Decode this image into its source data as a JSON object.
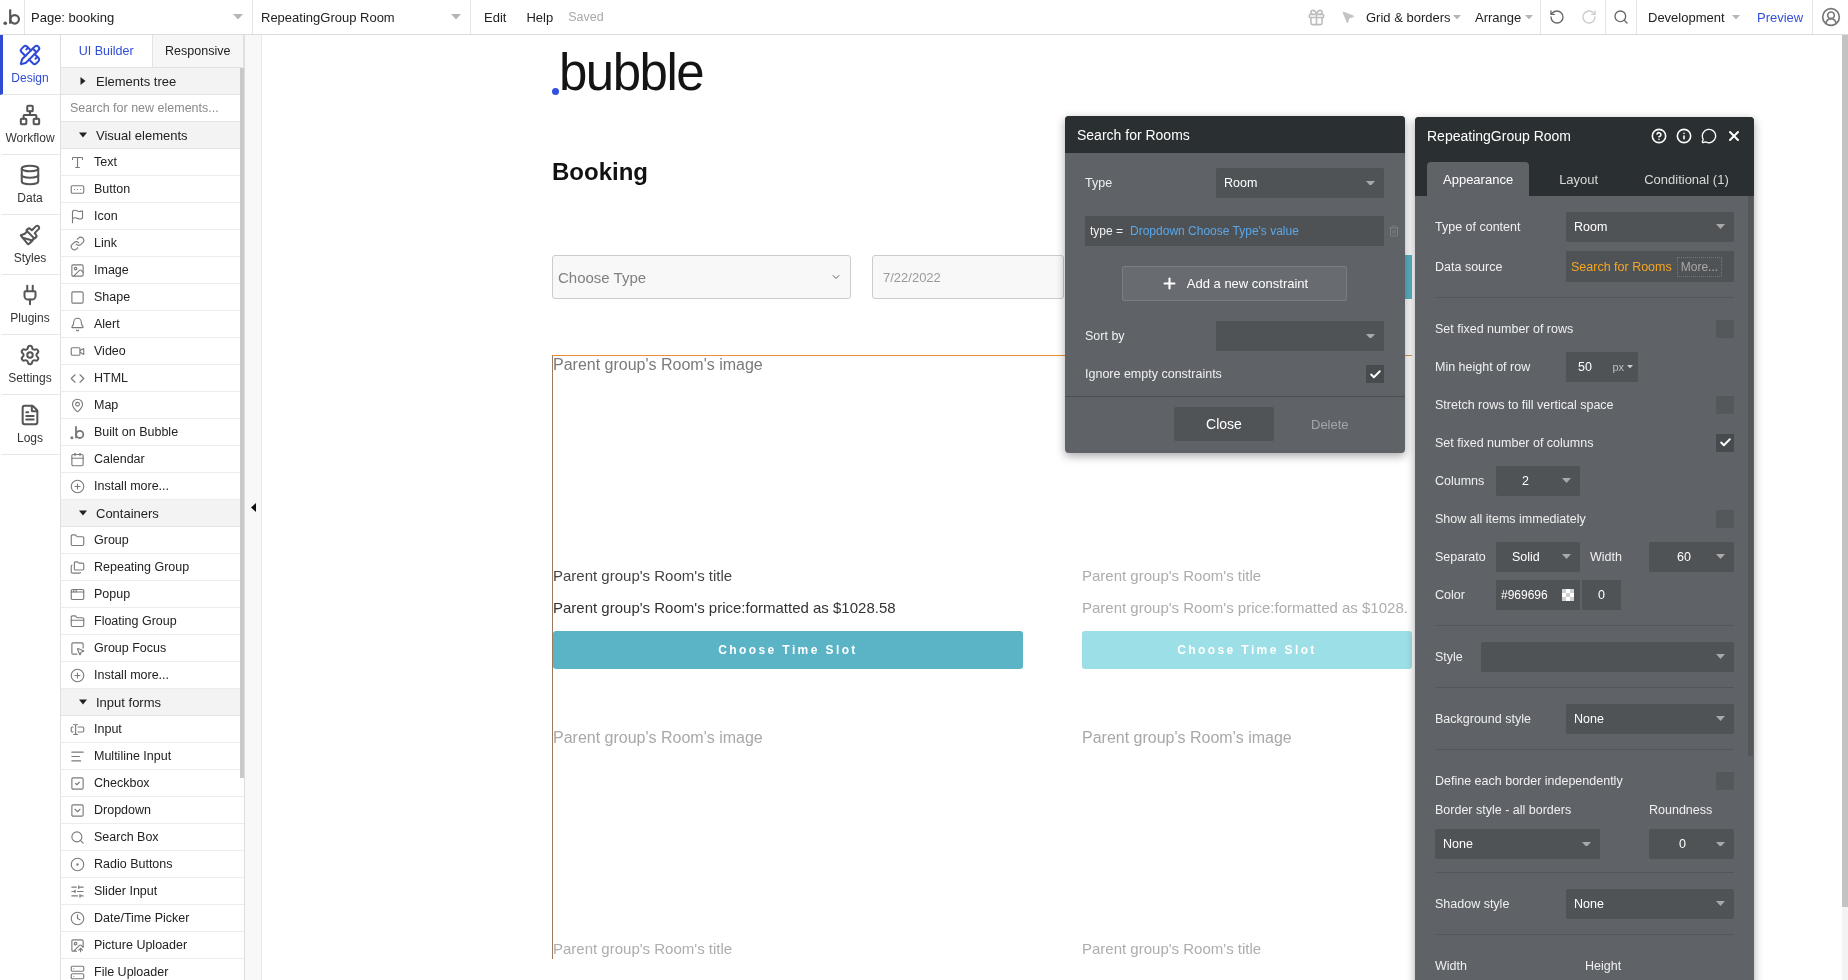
{
  "top_bar": {
    "page_selector": "Page: booking",
    "element_selector": "RepeatingGroup Room",
    "menu": [
      "Edit",
      "Help"
    ],
    "save_status": "Saved",
    "view_menus": [
      "Grid & borders",
      "Arrange"
    ],
    "undo": {
      "disabled": false
    },
    "redo": {
      "disabled": true
    },
    "version": "Development",
    "preview": "Preview"
  },
  "nav": [
    {
      "kind": "design",
      "label": "Design",
      "selected": true
    },
    {
      "kind": "workflow",
      "label": "Workflow",
      "selected": false
    },
    {
      "kind": "data",
      "label": "Data",
      "selected": false
    },
    {
      "kind": "styles",
      "label": "Styles",
      "selected": false
    },
    {
      "kind": "plugins",
      "label": "Plugins",
      "selected": false
    },
    {
      "kind": "settings",
      "label": "Settings",
      "selected": false
    },
    {
      "kind": "logs",
      "label": "Logs",
      "selected": false
    }
  ],
  "elements_panel": {
    "tabs": [
      {
        "label": "UI Builder",
        "selected": true
      },
      {
        "label": "Responsive",
        "selected": false
      }
    ],
    "tree": {
      "label": "Elements tree",
      "expanded": false
    },
    "search": {
      "placeholder": "Search for new elements..."
    },
    "groups": [
      {
        "label": "Visual elements",
        "expanded": true,
        "items": [
          {
            "kind": "text",
            "label": "Text"
          },
          {
            "kind": "button",
            "label": "Button"
          },
          {
            "kind": "icon",
            "label": "Icon"
          },
          {
            "kind": "link",
            "label": "Link"
          },
          {
            "kind": "image",
            "label": "Image"
          },
          {
            "kind": "shape",
            "label": "Shape"
          },
          {
            "kind": "alert",
            "label": "Alert"
          },
          {
            "kind": "video",
            "label": "Video"
          },
          {
            "kind": "html",
            "label": "HTML"
          },
          {
            "kind": "map",
            "label": "Map"
          },
          {
            "kind": "logo",
            "label": "Built on Bubble"
          },
          {
            "kind": "calendar",
            "label": "Calendar"
          },
          {
            "kind": "install",
            "label": "Install more..."
          }
        ]
      },
      {
        "label": "Containers",
        "expanded": true,
        "items": [
          {
            "kind": "group",
            "label": "Group"
          },
          {
            "kind": "repeating",
            "label": "Repeating Group"
          },
          {
            "kind": "popup",
            "label": "Popup"
          },
          {
            "kind": "floating",
            "label": "Floating Group"
          },
          {
            "kind": "focus",
            "label": "Group Focus"
          },
          {
            "kind": "install",
            "label": "Install more..."
          }
        ]
      },
      {
        "label": "Input forms",
        "expanded": true,
        "items": [
          {
            "kind": "input",
            "label": "Input"
          },
          {
            "kind": "multiline",
            "label": "Multiline Input"
          },
          {
            "kind": "checkbox",
            "label": "Checkbox"
          },
          {
            "kind": "dropdown",
            "label": "Dropdown"
          },
          {
            "kind": "search",
            "label": "Search Box"
          },
          {
            "kind": "radio",
            "label": "Radio Buttons"
          },
          {
            "kind": "slider",
            "label": "Slider Input"
          },
          {
            "kind": "datetime",
            "label": "Date/Time Picker"
          },
          {
            "kind": "picture",
            "label": "Picture Uploader"
          },
          {
            "kind": "file",
            "label": "File Uploader"
          }
        ]
      }
    ]
  },
  "canvas": {
    "logo": "bubble",
    "heading": "Booking",
    "type_dropdown": {
      "placeholder": "Choose Type"
    },
    "date_input": {
      "placeholder": "7/22/2022"
    },
    "repeating_group": {
      "rows": [
        {
          "cells": [
            {
              "image": "Parent group's Room's image",
              "title": "Parent group's Room's title",
              "price": "Parent group's Room's price:formatted as $1028.58",
              "button": "Choose Time Slot",
              "dimmed": false
            },
            {
              "title": "Parent group's Room's title",
              "price": "Parent group's Room's price:formatted as $1028.",
              "button": "Choose Time Slot",
              "dimmed": true
            }
          ]
        },
        {
          "cells": [
            {
              "image": "Parent group's Room's image",
              "title": "Parent group's Room's title",
              "dimmed": true
            },
            {
              "image": "Parent group's Room's image",
              "title": "Parent group's Room's title",
              "dimmed": true
            }
          ]
        }
      ]
    }
  },
  "search_panel": {
    "title": "Search for Rooms",
    "type": {
      "label": "Type",
      "value": "Room"
    },
    "constraints": [
      {
        "field": "type =",
        "value": "Dropdown Choose Type's value"
      }
    ],
    "add_button": "Add a new constraint",
    "sort": {
      "label": "Sort by"
    },
    "ignore_empty": {
      "label": "Ignore empty constraints",
      "checked": true
    },
    "close_button": "Close",
    "delete_button": {
      "label": "Delete",
      "disabled": true
    }
  },
  "property_panel": {
    "title": "RepeatingGroup Room",
    "tabs": [
      {
        "label": "Appearance",
        "selected": true
      },
      {
        "label": "Layout",
        "selected": false
      },
      {
        "label": "Conditional (1)",
        "selected": false
      }
    ],
    "sections": [
      {
        "rows": [
          {
            "kind": "select",
            "label": "Type of content",
            "value": "Room"
          },
          {
            "kind": "source",
            "label": "Data source",
            "value": "Search for Rooms",
            "more": "More..."
          }
        ]
      },
      {
        "rows": [
          {
            "kind": "toggle",
            "label": "Set fixed number of rows",
            "checked": false
          },
          {
            "kind": "number",
            "label": "Min height of row",
            "value": "50",
            "unit": "px"
          },
          {
            "kind": "toggle",
            "label": "Stretch rows to fill vertical space",
            "checked": false
          },
          {
            "kind": "toggle",
            "label": "Set fixed number of columns",
            "checked": true
          },
          {
            "kind": "small-select",
            "label": "Columns",
            "value": "2"
          },
          {
            "kind": "toggle",
            "label": "Show all items immediately",
            "checked": false
          },
          {
            "kind": "separator",
            "label": "Separato",
            "value": "Solid",
            "width_label": "Width",
            "width_value": "60"
          },
          {
            "kind": "color",
            "label": "Color",
            "value": "#969696",
            "opacity": "0"
          }
        ]
      },
      {
        "rows": [
          {
            "kind": "wide-select",
            "label": "Style"
          }
        ]
      },
      {
        "rows": [
          {
            "kind": "select",
            "label": "Background style",
            "value": "None"
          }
        ]
      },
      {
        "rows": [
          {
            "kind": "toggle",
            "label": "Define each border independently",
            "checked": false
          },
          {
            "kind": "border",
            "label": "Border style - all borders",
            "value": "None",
            "roundness_label": "Roundness",
            "roundness_value": "0"
          }
        ]
      },
      {
        "rows": [
          {
            "kind": "select",
            "label": "Shadow style",
            "value": "None"
          }
        ]
      },
      {
        "rows": [
          {
            "kind": "size",
            "label": "Width",
            "second_label": "Height"
          }
        ]
      }
    ]
  }
}
